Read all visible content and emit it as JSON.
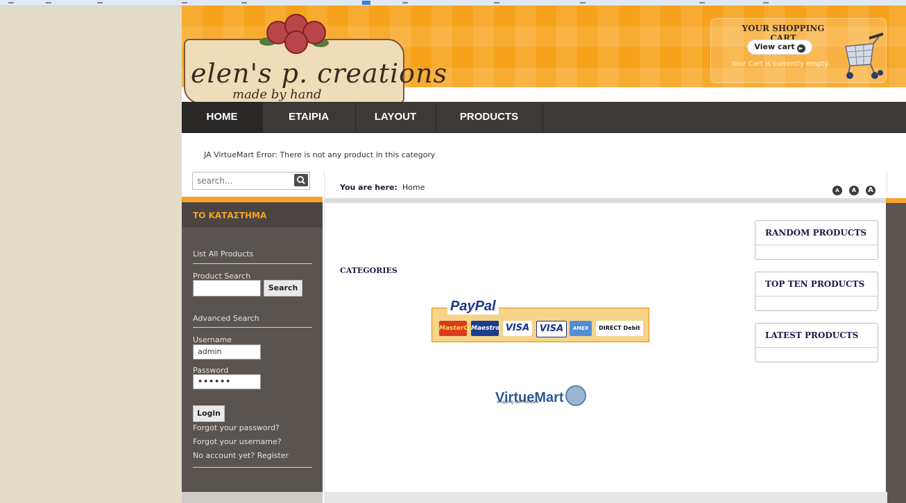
{
  "header": {
    "logo_line1": "elen's p. creations",
    "logo_line2": "made by hand"
  },
  "cart": {
    "title": "YOUR SHOPPING CART",
    "view_label": "View cart",
    "empty_text": "Your Cart is currently empty."
  },
  "nav": {
    "items": [
      {
        "label": "HOME"
      },
      {
        "label": "ΕΤΑΙΡΙΑ"
      },
      {
        "label": "LAYOUT"
      },
      {
        "label": "PRODUCTS"
      }
    ]
  },
  "error_message": "JA VirtueMart Error: There is not any product in this category",
  "search": {
    "placeholder": "search..."
  },
  "breadcrumb": {
    "prefix": "You are here:",
    "current": "Home"
  },
  "font_size_buttons": [
    "A",
    "A",
    "A"
  ],
  "store_menu": {
    "title": "ΤΟ ΚΑΤΑΣΤΗΜΑ",
    "list_all": "List All Products",
    "product_search": "Product Search",
    "search_button": "Search",
    "advanced_search": "Advanced Search",
    "username_label": "Username",
    "username_value": "admin",
    "password_label": "Password",
    "password_value": "••••••",
    "login_button": "Login",
    "forgot_password": "Forgot your password?",
    "forgot_username": "Forgot your username?",
    "register": "No account yet? Register"
  },
  "main": {
    "categories_title": "CATEGORIES",
    "paypal_label": "PayPal",
    "cards": [
      "MasterCard",
      "Maestro",
      "VISA",
      "VISA",
      "AMEX",
      "DIRECT Debit"
    ],
    "virtuemart_label": "VirtueMart",
    "virtuemart_sub": "shopping cart software"
  },
  "right_boxes": [
    {
      "title": "RANDOM PRODUCTS"
    },
    {
      "title": "TOP TEN PRODUCTS"
    },
    {
      "title": "LATEST PRODUCTS"
    }
  ],
  "colors": {
    "header_orange": "#f7a21a",
    "nav_dark": "#3c3936",
    "sidebar_brown": "#5a5450",
    "accent_orange": "#f4a22a"
  }
}
